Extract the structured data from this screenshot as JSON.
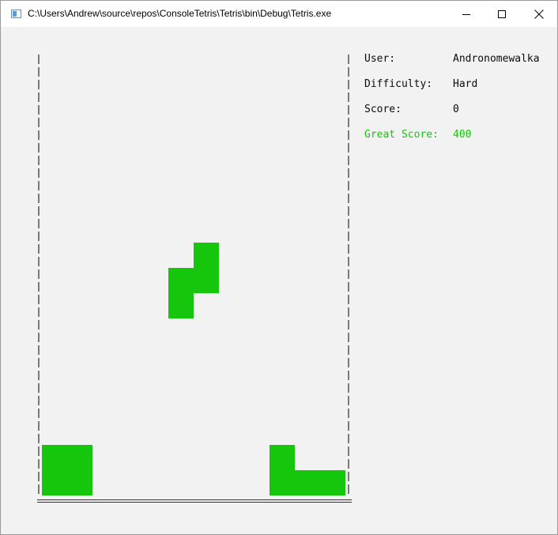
{
  "window": {
    "title": "C:\\Users\\Andrew\\source\\repos\\ConsoleTetris\\Tetris\\bin\\Debug\\Tetris.exe"
  },
  "info": {
    "user_label": "User:",
    "user_value": "Andronomewalka",
    "difficulty_label": "Difficulty:",
    "difficulty_value": "Hard",
    "score_label": "Score:",
    "score_value": "0",
    "great_score_label": "Great Score:",
    "great_score_value": "400"
  },
  "colors": {
    "block": "#16c60c",
    "text": "#0c0c0c",
    "highlight": "#16c60c",
    "background": "#f2f2f2"
  },
  "icons": [
    "app-icon",
    "minimize-icon",
    "maximize-icon",
    "close-icon"
  ]
}
